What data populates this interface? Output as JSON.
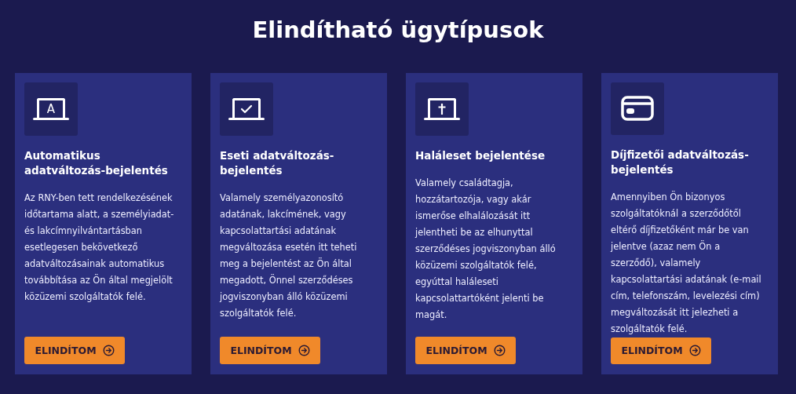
{
  "heading": "Elindítható ügytípusok",
  "cards": [
    {
      "kind": "laptop_letter",
      "icon_text": "A",
      "title": "Automatikus adatváltozás-bejelentés",
      "body": "Az RNY-ben tett rendelkezésének időtartama alatt, a személyiadat- és lakcímnyilvántartásban esetlegesen bekövetkező adatváltozásainak automatikus továbbítása az Ön által megjelölt közüzemi szolgáltatók felé.",
      "button": "ELINDÍTOM"
    },
    {
      "kind": "laptop_check",
      "title": "Eseti adatváltozás-bejelentés",
      "body": "Valamely személyazonosító adatának, lakcímének, vagy kapcsolattartási adatának megváltozása esetén itt teheti meg a bejelentést az Ön által megadott, Önnel szerződéses jogviszonyban álló közüzemi szolgáltatók felé.",
      "button": "ELINDÍTOM"
    },
    {
      "kind": "laptop_cross",
      "title": "Haláleset bejelentése",
      "body": "Valamely családtagja, hozzátartozója, vagy akár ismerőse elhalálozását itt jelentheti be az elhunyttal szerződéses jogviszonyban álló közüzemi szolgáltatók felé, egyúttal haláleseti kapcsolattartóként jelenti be magát.",
      "button": "ELINDÍTOM"
    },
    {
      "kind": "card",
      "title": "Díjfizetői adatváltozás-bejelentés",
      "body": "Amennyiben Ön bizonyos szolgáltatóknál a szerződőtől eltérő díjfizetőként már be van jelentve (azaz nem Ön a szerződő), valamely kapcsolattartási adatának (e-mail cím, telefonszám, levelezési cím) megváltozását itt jelezheti a szolgáltatók felé.",
      "button": "ELINDÍTOM"
    }
  ]
}
